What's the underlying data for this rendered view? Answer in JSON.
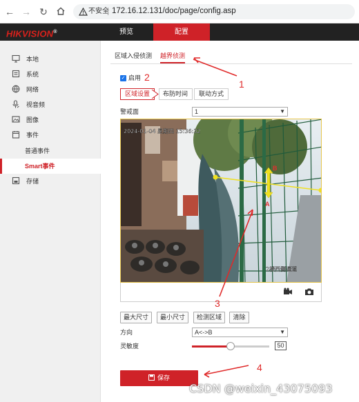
{
  "browser": {
    "not_secure": "不安全",
    "url": "172.16.12.131/doc/page/config.asp"
  },
  "header": {
    "logo": "HIKVISION",
    "logo_mark": "®",
    "nav_preview": "预览",
    "nav_config": "配置"
  },
  "sidebar": {
    "items": [
      {
        "label": "本地",
        "icon": "monitor-icon"
      },
      {
        "label": "系统",
        "icon": "system-icon"
      },
      {
        "label": "网络",
        "icon": "globe-icon"
      },
      {
        "label": "视音频",
        "icon": "microphone-icon"
      },
      {
        "label": "图像",
        "icon": "image-icon"
      },
      {
        "label": "事件",
        "icon": "calendar-icon"
      },
      {
        "label": "普通事件"
      },
      {
        "label": "Smart事件",
        "active": true
      },
      {
        "label": "存储",
        "icon": "storage-icon"
      }
    ]
  },
  "tabs": {
    "intrusion": "区域入侵侦测",
    "line_crossing": "越界侦测"
  },
  "enable": {
    "label": "启用",
    "checked": true
  },
  "subtabs": {
    "area": "区域设置",
    "schedule": "布防时间",
    "linkage": "联动方式"
  },
  "warning_area": {
    "label": "警戒面",
    "value": "1"
  },
  "video": {
    "osd_date": "2024-01-04 星期四 15:36:32",
    "osd_camera": "2楼西侧通道",
    "marker_a": "A",
    "marker_b": "B"
  },
  "buttons": {
    "max_size": "最大尺寸",
    "min_size": "最小尺寸",
    "detect_area": "检测区域",
    "clear": "清除"
  },
  "direction": {
    "label": "方向",
    "value": "A<->B"
  },
  "sensitivity": {
    "label": "灵敏度",
    "value": 50,
    "display": "50"
  },
  "save": {
    "label": "保存"
  },
  "annotations": {
    "n1": "1",
    "n2": "2",
    "n3": "3",
    "n4": "4"
  },
  "watermark": "CSDN @weixin_43075093",
  "colors": {
    "brand_red": "#cf2228",
    "header_bg": "#222222",
    "line_yellow": "#f0e020",
    "annotation_red": "#e02a2a"
  }
}
